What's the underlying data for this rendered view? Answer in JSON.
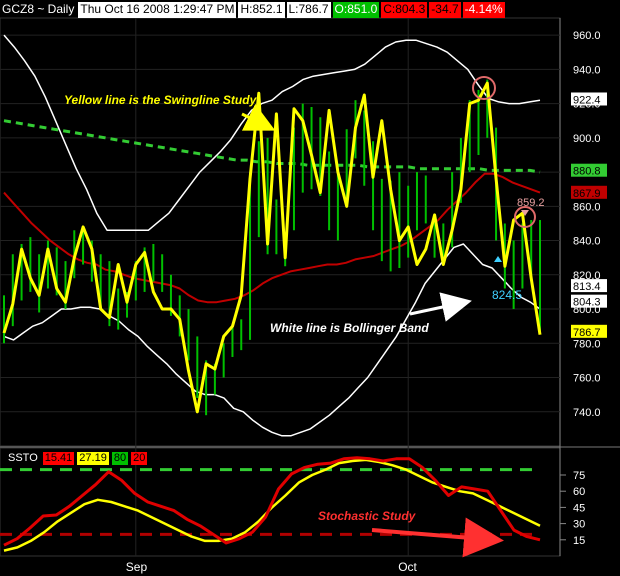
{
  "header": {
    "symbol": "GCZ8 ~ Daily",
    "datetime": "Thu Oct 16 2008 1:29:47 PM",
    "high": "H:852.1",
    "low": "L:786.7",
    "open": "O:851.0",
    "close": "C:804.3",
    "change": "-34.7",
    "pct": "-4.14%"
  },
  "stoch_header": {
    "name": "SSTO",
    "k": "15.41",
    "d": "27.19",
    "ob": "80",
    "os": "20"
  },
  "colors": {
    "background": "#000000",
    "bars": "#00c000",
    "swingline": "#ffff00",
    "bollinger": "#ffffff",
    "ma_red": "#c00000",
    "ma_green": "#33cc33",
    "stoch_k": "#e00000",
    "stoch_d": "#ffff00"
  },
  "chart_data": [
    {
      "type": "ohlc",
      "panel": "price",
      "y_ticks": [
        740,
        760,
        780,
        800,
        820,
        840,
        860,
        880,
        900,
        920,
        940,
        960
      ],
      "y_tick_labels": [
        "740.0",
        "760.0",
        "780.0",
        "800.0",
        "820.0",
        "840.0",
        "860.0",
        "880.0",
        "900.0",
        "920.0",
        "940.0",
        "960.0"
      ],
      "ylim": [
        720,
        970
      ],
      "x_labels": [
        {
          "label": "Sep",
          "index": 15
        },
        {
          "label": "Oct",
          "index": 46
        }
      ],
      "n_bars": 62,
      "bars_high": [
        808,
        832,
        838,
        842,
        832,
        840,
        836,
        828,
        846,
        848,
        840,
        832,
        828,
        812,
        810,
        828,
        836,
        838,
        832,
        820,
        808,
        800,
        784,
        770,
        768,
        780,
        790,
        794,
        880,
        898,
        900,
        864,
        830,
        906,
        920,
        918,
        912,
        892,
        880,
        905,
        922,
        916,
        898,
        876,
        875,
        880,
        872,
        880,
        878,
        855,
        850,
        880,
        900,
        922,
        928,
        934,
        906,
        850,
        840,
        850,
        852,
        852
      ],
      "bars_low": [
        780,
        790,
        805,
        810,
        798,
        812,
        808,
        800,
        818,
        826,
        816,
        800,
        790,
        788,
        795,
        805,
        810,
        816,
        810,
        796,
        784,
        770,
        748,
        738,
        750,
        760,
        772,
        776,
        782,
        842,
        832,
        832,
        825,
        846,
        868,
        870,
        866,
        846,
        840,
        860,
        888,
        872,
        846,
        828,
        822,
        824,
        830,
        846,
        850,
        830,
        826,
        836,
        862,
        880,
        890,
        900,
        840,
        812,
        800,
        812,
        820,
        786
      ],
      "series": [
        {
          "name": "Swingline Study",
          "values": [
            786,
            803,
            835,
            818,
            808,
            835,
            812,
            804,
            830,
            848,
            835,
            800,
            795,
            826,
            804,
            826,
            833,
            810,
            800,
            800,
            794,
            764,
            740,
            768,
            765,
            784,
            790,
            808,
            876,
            926,
            838,
            914,
            830,
            917,
            910,
            890,
            868,
            916,
            880,
            860,
            906,
            925,
            877,
            910,
            870,
            840,
            848,
            826,
            835,
            855,
            826,
            846,
            870,
            920,
            922,
            932,
            876,
            825,
            852,
            856,
            818,
            785
          ],
          "color": "#ffff00"
        },
        {
          "name": "Bollinger Band",
          "values": [
            960,
            953,
            945,
            936,
            924,
            910,
            896,
            882,
            870,
            856,
            846,
            846,
            846,
            846,
            846,
            851,
            856,
            864,
            872,
            880,
            886,
            892,
            899,
            908,
            916,
            920,
            922,
            927,
            930,
            934,
            936,
            937,
            938,
            939,
            940,
            943,
            948,
            953,
            956,
            957,
            957,
            955,
            953,
            950,
            945,
            940,
            931,
            923,
            921,
            920,
            920,
            921,
            922
          ],
          "color": "#ffffff"
        },
        {
          "name": "",
          "values": [
            784,
            782,
            786,
            790,
            792,
            796,
            800,
            800,
            801,
            801,
            800,
            796,
            793,
            788,
            784,
            778,
            773,
            768,
            762,
            757,
            752,
            750,
            750,
            748,
            742,
            740,
            735,
            731,
            728,
            726,
            726,
            728,
            730,
            734,
            738,
            743,
            748,
            754,
            760,
            768,
            776,
            784,
            794,
            804,
            815,
            822,
            829,
            836,
            838,
            832,
            826,
            824,
            818,
            812,
            807,
            804,
            800
          ],
          "color": "#ffffff"
        },
        {
          "name": "",
          "values": [
            868,
            862,
            856,
            850,
            845,
            840,
            836,
            832,
            829,
            827,
            826,
            823,
            822,
            820,
            818,
            817,
            816,
            815,
            814,
            812,
            808,
            805,
            804,
            804,
            805,
            806,
            808,
            811,
            815,
            818,
            820,
            822,
            823,
            824,
            825,
            826,
            826,
            827,
            829,
            830,
            831,
            833,
            835,
            837,
            840,
            844,
            848,
            852,
            858,
            863,
            868,
            874,
            879,
            879,
            877,
            874,
            872,
            870,
            868
          ],
          "color": "#c00000"
        },
        {
          "name": "",
          "values": [
            910,
            909,
            908,
            907,
            906,
            905,
            904,
            903,
            902,
            901,
            900,
            899,
            898,
            897,
            896,
            895,
            894,
            893,
            892,
            891,
            890,
            889,
            888,
            887,
            887,
            886,
            886,
            885,
            885,
            885,
            884,
            884,
            884,
            884,
            884,
            884,
            883,
            883,
            883,
            883,
            883,
            882,
            882,
            882,
            882,
            882,
            882,
            882,
            881,
            881,
            881,
            881,
            881,
            880
          ],
          "color": "#33cc33"
        }
      ],
      "value_labels": [
        "922.4",
        "880.8",
        "867.9",
        "813.4",
        "804.3",
        "786.7"
      ],
      "annotations": [
        "Yellow line is the Swingline Study",
        "White line is Bollinger Band",
        "859.2",
        "824.5"
      ]
    },
    {
      "type": "line",
      "panel": "stochastic",
      "title": "SSTO",
      "y_ticks": [
        15,
        30,
        45,
        60,
        75
      ],
      "y_tick_labels": [
        "15",
        "30",
        "45",
        "60",
        "75"
      ],
      "ylim": [
        0,
        100
      ],
      "series": [
        {
          "name": "SSTO",
          "values": [
            10,
            16,
            26,
            37,
            38,
            46,
            56,
            66,
            78,
            70,
            58,
            50,
            46,
            42,
            34,
            28,
            20,
            12,
            16,
            22,
            36,
            62,
            76,
            82,
            85,
            86,
            90,
            91,
            90,
            88,
            90,
            90,
            82,
            70,
            56,
            64,
            62,
            60,
            42,
            24,
            18,
            15
          ],
          "color": "#e00000"
        },
        {
          "name": "SSTO",
          "values": [
            5,
            8,
            14,
            22,
            32,
            40,
            48,
            52,
            50,
            46,
            42,
            36,
            30,
            24,
            18,
            14,
            14,
            16,
            22,
            32,
            45,
            56,
            68,
            75,
            80,
            86,
            88,
            89,
            87,
            84,
            80,
            74,
            68,
            64,
            60,
            58,
            52,
            46,
            40,
            34,
            28
          ],
          "color": "#ffff00"
        }
      ],
      "reference_lines": [
        80,
        20
      ],
      "annotations": [
        "Stochastic Study"
      ]
    }
  ]
}
